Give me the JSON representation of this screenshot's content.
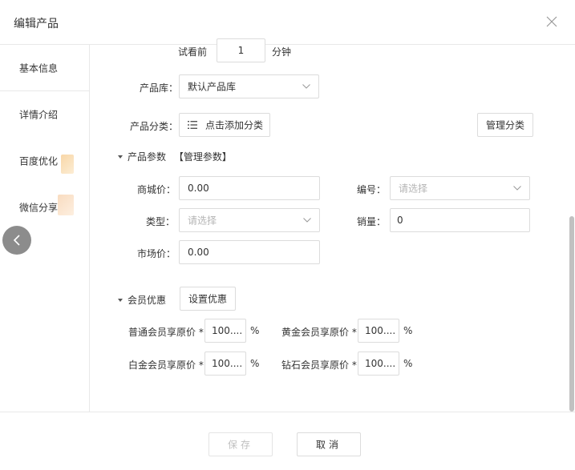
{
  "header": {
    "title": "编辑产品"
  },
  "sidebar": {
    "items": [
      {
        "label": "基本信息"
      },
      {
        "label": "详情介绍"
      },
      {
        "label": "百度优化"
      },
      {
        "label": "微信分享"
      }
    ]
  },
  "preview": {
    "prefix": "试看前",
    "value": "1",
    "suffix": "分钟"
  },
  "library": {
    "label": "产品库：",
    "value": "默认产品库"
  },
  "category": {
    "label": "产品分类：",
    "add_label": "点击添加分类",
    "manage_label": "管理分类"
  },
  "params": {
    "title": "产品参数",
    "manage_link": "【管理参数】",
    "mall_price": {
      "label": "商城价：",
      "value": "0.00"
    },
    "number": {
      "label": "编号：",
      "placeholder": "请选择"
    },
    "type": {
      "label": "类型：",
      "placeholder": "请选择"
    },
    "sales": {
      "label": "销量：",
      "value": "0"
    },
    "market_price": {
      "label": "市场价：",
      "value": "0.00"
    }
  },
  "member": {
    "title": "会员优惠",
    "setup_label": "设置优惠",
    "tiers": [
      {
        "label": "普通会员享原价 *",
        "value": "100....",
        "unit": "%"
      },
      {
        "label": "黄金会员享原价 *",
        "value": "100....",
        "unit": "%"
      },
      {
        "label": "白金会员享原价 *",
        "value": "100....",
        "unit": "%"
      },
      {
        "label": "钻石会员享原价 *",
        "value": "100....",
        "unit": "%"
      }
    ]
  },
  "footer": {
    "save_label": "保存",
    "cancel_label": "取消"
  },
  "colors": {
    "accent": "#3a7bd5",
    "border": "#dcdcdc",
    "placeholder": "#b4b4b4"
  },
  "icons": [
    "close-icon",
    "chevron-down-icon",
    "list-icon",
    "chevron-left-icon",
    "caret-down-icon"
  ]
}
